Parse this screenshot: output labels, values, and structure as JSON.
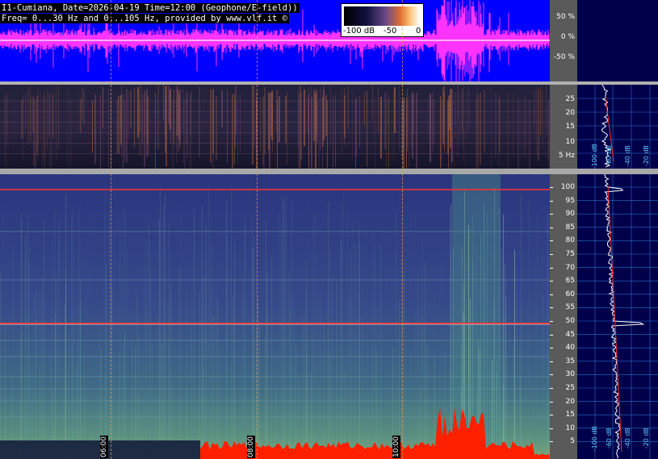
{
  "header": {
    "line1": "I1-Cumiana, Date=2026-04-19 Time=12:00 (Geophone/E-field))",
    "line2": "Freq= 0...30 Hz and 0...105 Hz, provided by www.vlf.it ©"
  },
  "colorbar": {
    "min_label": "-100 dB",
    "mid_label": "-50",
    "max_label": "0"
  },
  "waveform_scale": [
    "50 %",
    "0 %",
    "-50 %"
  ],
  "lf_scale": [
    "25",
    "20",
    "15",
    "10",
    "5 Hz"
  ],
  "main_scale": [
    "100",
    "95",
    "90",
    "85",
    "80",
    "75",
    "70",
    "65",
    "60",
    "55",
    "50",
    "45",
    "40",
    "35",
    "30",
    "25",
    "20",
    "15",
    "10",
    "5"
  ],
  "time_markers": [
    "06:00",
    "08:00",
    "10:00"
  ],
  "side_lf_labels": [
    "-100 dB",
    "-60 dB",
    "-40 dB",
    "-20 dB"
  ],
  "side_main_labels": [
    "-100 dB",
    "-60 dB",
    "-40 dB",
    "-20 dB"
  ],
  "colors": {
    "waveform_bg": "#0000ff",
    "waveform_trace": "#ff33ff",
    "spectrogram_bg": "#2f3c86",
    "powerline": "#ff3030",
    "lowfreq_noise": "#ff2000",
    "side_bg": "#00004a",
    "grid": "#3aa0ff"
  }
}
